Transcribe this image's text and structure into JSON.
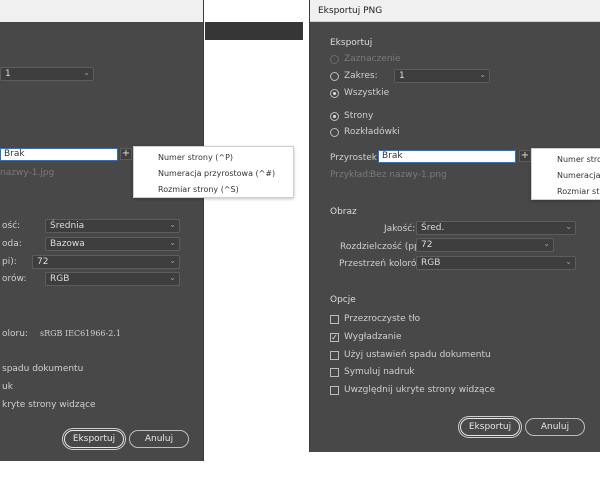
{
  "left_dialog": {
    "range_value": "1",
    "prefix_value": "Brak",
    "popup": {
      "items": [
        "Numer strony (^P)",
        "Numeracja przyrostowa (^#)",
        "Rozmiar strony (^S)"
      ]
    },
    "example": "nazwy-1.jpg",
    "rows": [
      {
        "label": "ość:",
        "value": "Średnia"
      },
      {
        "label": "oda:",
        "value": "Bazowa"
      },
      {
        "label": "pi):",
        "value": "72"
      },
      {
        "label": "orów:",
        "value": "RGB"
      }
    ],
    "profile_label": "oloru:",
    "profile_value": "sRGB IEC61966-2.1",
    "options": [
      "spadu dokumentu",
      "uk",
      "kryte strony widzące"
    ],
    "export_button": "Eksportuj",
    "cancel_button": "Anuluj"
  },
  "right_dialog": {
    "title": "Eksportuj PNG",
    "export_section": "Eksportuj",
    "selection_label": "Zaznaczenie",
    "range_label": "Zakres:",
    "range_value": "1",
    "all_label": "Wszystkie",
    "pages_label": "Strony",
    "spreads_label": "Rozkładówki",
    "suffix_label": "Przyrostek:",
    "suffix_value": "Brak",
    "example_label": "Przykład:",
    "example_value": "Bez nazwy-1.png",
    "popup": {
      "items": [
        "Numer stro",
        "Numeracja p",
        "Rozmiar stro"
      ]
    },
    "image_section": "Obraz",
    "quality_label": "Jakość:",
    "quality_value": "Śred.",
    "resolution_label": "Rozdzielczość (ppi):",
    "resolution_value": "72",
    "colorspace_label": "Przestrzeń kolorów:",
    "colorspace_value": "RGB",
    "options_section": "Opcje",
    "options": [
      {
        "label": "Przezroczyste tło",
        "checked": false
      },
      {
        "label": "Wygładzanie",
        "checked": true
      },
      {
        "label": "Użyj ustawień spadu dokumentu",
        "checked": false
      },
      {
        "label": "Symuluj nadruk",
        "checked": false
      },
      {
        "label": "Uwzględnij ukryte strony widzące",
        "checked": false
      }
    ],
    "export_button": "Eksportuj",
    "cancel_button": "Anuluj"
  },
  "icons": {
    "dropdown": "chevron-down-icon",
    "add": "plus-icon",
    "check": "checkmark-icon"
  },
  "colors": {
    "panel": "#484848",
    "focus": "#1a73e8"
  }
}
